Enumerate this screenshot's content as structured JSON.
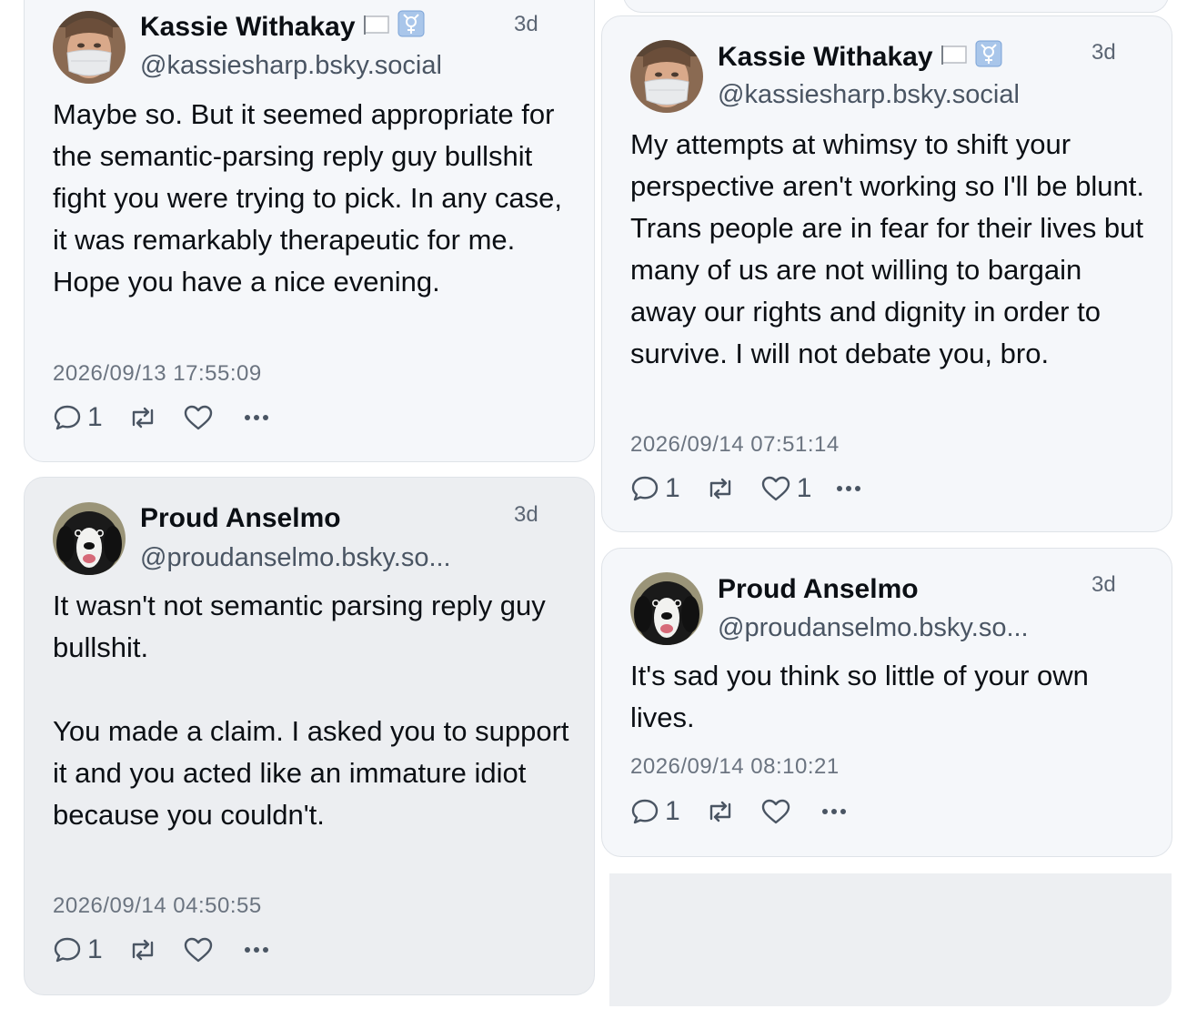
{
  "posts": [
    {
      "author": "Kassie Withakay",
      "handle": "@kassiesharp.bsky.social",
      "age": "3d",
      "text": "Maybe so. But it seemed appropriate for the semantic-parsing reply guy bullshit fight you were trying to pick. In any case, it was remarkably therapeutic for me. Hope you have a nice evening.",
      "timestamp": "2026/09/13 17:55:09",
      "reply_count": "1",
      "like_count": "",
      "avatar": "masked-person-avatar",
      "badges": [
        "white-flag-icon",
        "transgender-symbol-icon"
      ]
    },
    {
      "author": "Proud Anselmo",
      "handle": "@proudanselmo.bsky.so...",
      "age": "3d",
      "text": "It wasn't not semantic parsing reply guy bullshit.\n\nYou made a claim. I asked you to support it and you acted like an immature idiot because you couldn't.",
      "timestamp": "2026/09/14 04:50:55",
      "reply_count": "1",
      "like_count": "",
      "avatar": "dog-avatar",
      "badges": []
    },
    {
      "author": "Kassie Withakay",
      "handle": "@kassiesharp.bsky.social",
      "age": "3d",
      "text": "My attempts at whimsy to shift your perspective aren't working so I'll be blunt. Trans people are in fear for their lives but many of us are not willing to bargain away our rights and dignity in order to survive. I will not debate you, bro.",
      "timestamp": "2026/09/14 07:51:14",
      "reply_count": "1",
      "like_count": "1",
      "avatar": "masked-person-avatar",
      "badges": [
        "white-flag-icon",
        "transgender-symbol-icon"
      ]
    },
    {
      "author": "Proud Anselmo",
      "handle": "@proudanselmo.bsky.so...",
      "age": "3d",
      "text": "It's sad you think so little of your own lives.",
      "timestamp": "2026/09/14 08:10:21",
      "reply_count": "1",
      "like_count": "",
      "avatar": "dog-avatar",
      "badges": []
    }
  ],
  "icons": {
    "reply": "speech-bubble-icon",
    "repost": "repost-arrows-icon",
    "like": "heart-icon",
    "more": "ellipsis-icon"
  },
  "colors": {
    "card_bg": "#f5f7fa",
    "card_bg_alt": "#eceef1",
    "border": "#dfe3e8",
    "text": "#0b0f14",
    "muted": "#4a5563"
  }
}
